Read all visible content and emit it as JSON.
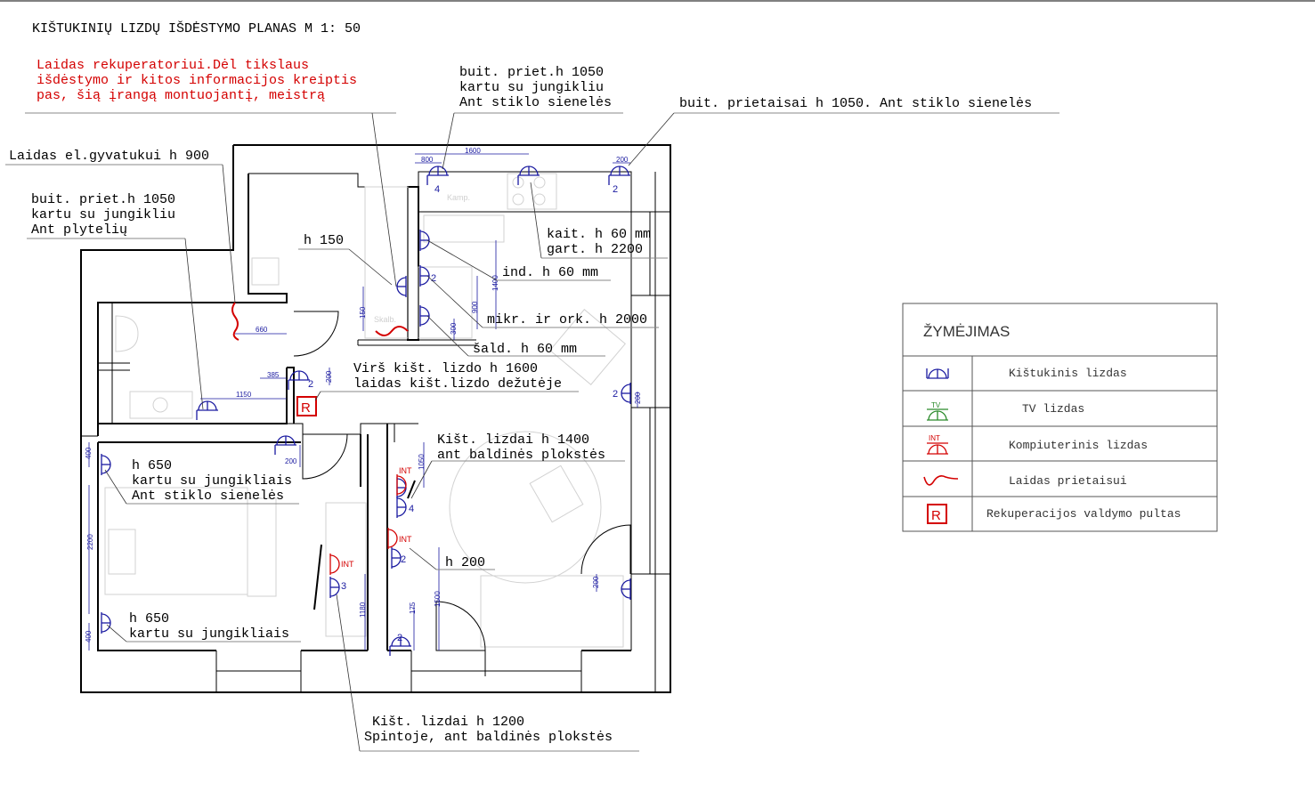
{
  "title": "KIŠTUKINIŲ LIZDŲ IŠDĖSTYMO PLANAS  M 1: 50",
  "annotations": {
    "recuperator_note": [
      "Laidas rekuperatoriui.Dėl tikslaus",
      "išdėstymo ir kitos informacijos kreiptis",
      "pas, šią įrangą montuojantį, meistrą"
    ],
    "kitchen_top": [
      "buit. priet.h 1050",
      "kartu su jungikliu",
      "Ant stiklo sienelės"
    ],
    "kitchen_right": "buit. prietaisai h 1050. Ant stiklo sienelės",
    "serpentine": "Laidas el.gyvatukui h 900",
    "bath": [
      "buit. priet.h 1050",
      "kartu su jungikliu",
      "Ant plytelių"
    ],
    "h150": "h 150",
    "cooktop": [
      "kait. h 60 mm",
      "gart. h 2200"
    ],
    "induction": "ind. h 60 mm",
    "microwave": "mikr. ir ork. h 2000",
    "fridge": "šald. h 60 mm",
    "above_socket": [
      "Virš kišt. lizdo h 1600",
      "laidas kišt.lizdo dežutėje"
    ],
    "living_sockets": [
      "Kišt. lizdai h 1400",
      "ant baldinės plokstės"
    ],
    "bedroom_top": [
      "h 650",
      "kartu su jungikliais",
      "Ant stiklo sienelės"
    ],
    "h200": "h 200",
    "bedroom_bottom": [
      "h 650",
      "kartu su jungikliais"
    ],
    "wardrobe": [
      "Kišt. lizdai h 1200",
      "Spintoje, ant baldinės plokstės"
    ]
  },
  "dimensions": {
    "d1600": "1600",
    "d800": "800",
    "d200a": "200",
    "d660": "660",
    "d150": "150",
    "d1400": "1400",
    "d900": "900",
    "d300": "300",
    "d385": "385",
    "d200b": "200",
    "d1150": "1150",
    "d400": "400",
    "d200c": "200",
    "d2200": "2200",
    "d400b": "400",
    "d1050": "1050",
    "d1180": "1180",
    "d1500": "1500",
    "d175": "175",
    "d200d": "200",
    "d200e": "200"
  },
  "socket_counts": {
    "k_top_left": "4",
    "k_top_right": "2",
    "k_island": "2",
    "k_right": "2",
    "living_left": "4",
    "living_mid": "2",
    "living_bottom": "2",
    "wardrobe": "3",
    "bed_switch": "2"
  },
  "int_labels": {
    "a": "INT",
    "b": "INT",
    "c": "INT"
  },
  "room_texts": {
    "kamp": "Kamp.",
    "skalb": "Skalb."
  },
  "legend": {
    "heading": "ŽYMĖJIMAS",
    "rows": [
      {
        "label": "Kištukinis lizdas",
        "icon": "socket-icon"
      },
      {
        "label": "TV  lizdas",
        "icon": "tv-socket-icon",
        "tag": "TV"
      },
      {
        "label": "Kompiuterinis lizdas",
        "icon": "computer-socket-icon",
        "tag": "INT"
      },
      {
        "label": "Laidas prietaisui",
        "icon": "cable-icon"
      },
      {
        "label": "Rekuperacijos valdymo pultas",
        "icon": "recuperation-panel-icon",
        "tag": "R"
      }
    ]
  },
  "colors": {
    "dim_blue": "#1a1aa0",
    "red": "#d40000",
    "green": "#2a8a2a",
    "text": "#000000"
  }
}
